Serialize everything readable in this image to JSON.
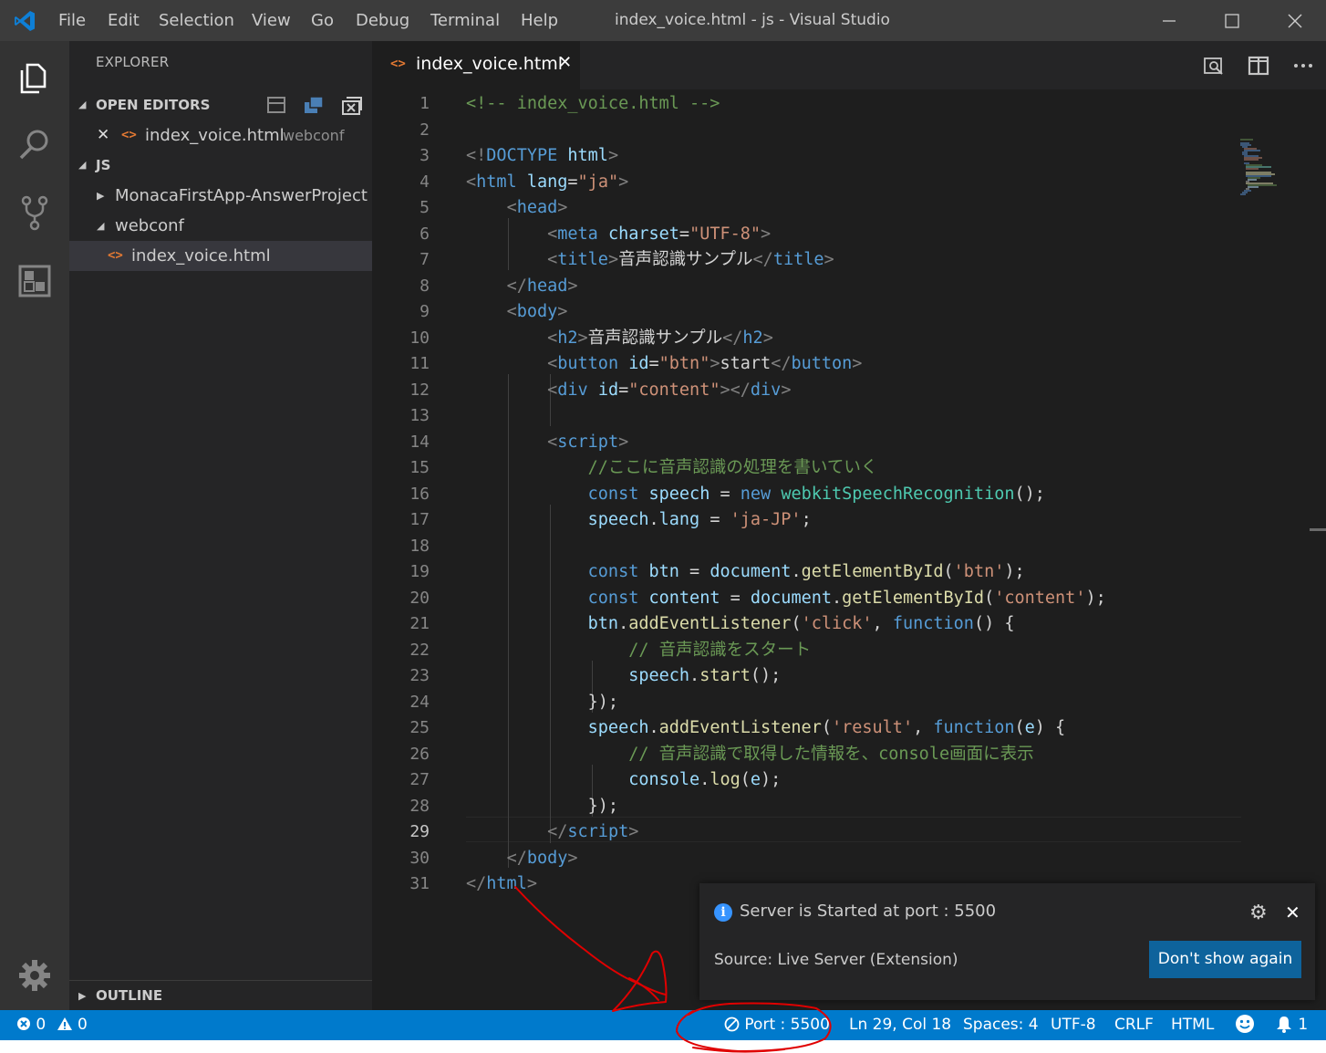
{
  "titlebar": {
    "menu": [
      "File",
      "Edit",
      "Selection",
      "View",
      "Go",
      "Debug",
      "Terminal",
      "Help"
    ],
    "window_title": "index_voice.html - js - Visual Studio Code"
  },
  "activitybar": {
    "icons": [
      "explorer-icon",
      "search-icon",
      "source-control-icon",
      "extensions-icon",
      "settings-gear-icon"
    ]
  },
  "sidebar": {
    "title": "EXPLORER",
    "open_editors": {
      "header": "OPEN EDITORS",
      "items": [
        {
          "close": "✕",
          "icon": "<>",
          "name": "index_voice.html",
          "folder": "webconf"
        }
      ]
    },
    "workspace": {
      "header": "JS",
      "items": [
        {
          "twisty": "▶",
          "name": "MonacaFirstApp-AnswerProject"
        },
        {
          "twisty": "◢",
          "name": "webconf"
        },
        {
          "icon": "<>",
          "name": "index_voice.html"
        }
      ]
    },
    "outline": {
      "twisty": "▶",
      "header": "OUTLINE"
    }
  },
  "editor": {
    "tab": {
      "icon": "<>",
      "label": "index_voice.html",
      "close": "✕"
    },
    "active_line": 29,
    "line_numbers": [
      "1",
      "2",
      "3",
      "4",
      "5",
      "6",
      "7",
      "8",
      "9",
      "10",
      "11",
      "12",
      "13",
      "14",
      "15",
      "16",
      "17",
      "18",
      "19",
      "20",
      "21",
      "22",
      "23",
      "24",
      "25",
      "26",
      "27",
      "28",
      "29",
      "30",
      "31"
    ],
    "lines": [
      [
        [
          "c",
          "<!-- index_voice.html -->"
        ]
      ],
      [],
      [
        [
          "b",
          "<!"
        ],
        [
          "tag",
          "DOCTYPE"
        ],
        [
          "txt",
          " "
        ],
        [
          "at",
          "html"
        ],
        [
          "b",
          ">"
        ]
      ],
      [
        [
          "b",
          "<"
        ],
        [
          "tag",
          "html"
        ],
        [
          "txt",
          " "
        ],
        [
          "at",
          "lang"
        ],
        [
          "txt",
          "="
        ],
        [
          "str",
          "\"ja\""
        ],
        [
          "b",
          ">"
        ]
      ],
      [
        [
          "txt",
          "    "
        ],
        [
          "b",
          "<"
        ],
        [
          "tag",
          "head"
        ],
        [
          "b",
          ">"
        ]
      ],
      [
        [
          "txt",
          "        "
        ],
        [
          "b",
          "<"
        ],
        [
          "tag",
          "meta"
        ],
        [
          "txt",
          " "
        ],
        [
          "at",
          "charset"
        ],
        [
          "txt",
          "="
        ],
        [
          "str",
          "\"UTF-8\""
        ],
        [
          "b",
          ">"
        ]
      ],
      [
        [
          "txt",
          "        "
        ],
        [
          "b",
          "<"
        ],
        [
          "tag",
          "title"
        ],
        [
          "b",
          ">"
        ],
        [
          "txt",
          "音声認識サンプル"
        ],
        [
          "b",
          "</"
        ],
        [
          "tag",
          "title"
        ],
        [
          "b",
          ">"
        ]
      ],
      [
        [
          "txt",
          "    "
        ],
        [
          "b",
          "</"
        ],
        [
          "tag",
          "head"
        ],
        [
          "b",
          ">"
        ]
      ],
      [
        [
          "txt",
          "    "
        ],
        [
          "b",
          "<"
        ],
        [
          "tag",
          "body"
        ],
        [
          "b",
          ">"
        ]
      ],
      [
        [
          "txt",
          "        "
        ],
        [
          "b",
          "<"
        ],
        [
          "tag",
          "h2"
        ],
        [
          "b",
          ">"
        ],
        [
          "txt",
          "音声認識サンプル"
        ],
        [
          "b",
          "</"
        ],
        [
          "tag",
          "h2"
        ],
        [
          "b",
          ">"
        ]
      ],
      [
        [
          "txt",
          "        "
        ],
        [
          "b",
          "<"
        ],
        [
          "tag",
          "button"
        ],
        [
          "txt",
          " "
        ],
        [
          "at",
          "id"
        ],
        [
          "txt",
          "="
        ],
        [
          "str",
          "\"btn\""
        ],
        [
          "b",
          ">"
        ],
        [
          "txt",
          "start"
        ],
        [
          "b",
          "</"
        ],
        [
          "tag",
          "button"
        ],
        [
          "b",
          ">"
        ]
      ],
      [
        [
          "txt",
          "        "
        ],
        [
          "b",
          "<"
        ],
        [
          "tag",
          "div"
        ],
        [
          "txt",
          " "
        ],
        [
          "at",
          "id"
        ],
        [
          "txt",
          "="
        ],
        [
          "str",
          "\"content\""
        ],
        [
          "b",
          "></"
        ],
        [
          "tag",
          "div"
        ],
        [
          "b",
          ">"
        ]
      ],
      [],
      [
        [
          "txt",
          "        "
        ],
        [
          "b",
          "<"
        ],
        [
          "tag",
          "script"
        ],
        [
          "b",
          ">"
        ]
      ],
      [
        [
          "txt",
          "            "
        ],
        [
          "c",
          "//ここに音声認識の処理を書いていく"
        ]
      ],
      [
        [
          "txt",
          "            "
        ],
        [
          "kw",
          "const"
        ],
        [
          "txt",
          " "
        ],
        [
          "var",
          "speech"
        ],
        [
          "txt",
          " = "
        ],
        [
          "kw",
          "new"
        ],
        [
          "txt",
          " "
        ],
        [
          "cls",
          "webkitSpeechRecognition"
        ],
        [
          "txt",
          "();"
        ]
      ],
      [
        [
          "txt",
          "            "
        ],
        [
          "var",
          "speech"
        ],
        [
          "txt",
          "."
        ],
        [
          "var",
          "lang"
        ],
        [
          "txt",
          " = "
        ],
        [
          "str",
          "'ja-JP'"
        ],
        [
          "txt",
          ";"
        ]
      ],
      [],
      [
        [
          "txt",
          "            "
        ],
        [
          "kw",
          "const"
        ],
        [
          "txt",
          " "
        ],
        [
          "var",
          "btn"
        ],
        [
          "txt",
          " = "
        ],
        [
          "var",
          "document"
        ],
        [
          "txt",
          "."
        ],
        [
          "fn",
          "getElementById"
        ],
        [
          "txt",
          "("
        ],
        [
          "str",
          "'btn'"
        ],
        [
          "txt",
          ");"
        ]
      ],
      [
        [
          "txt",
          "            "
        ],
        [
          "kw",
          "const"
        ],
        [
          "txt",
          " "
        ],
        [
          "var",
          "content"
        ],
        [
          "txt",
          " = "
        ],
        [
          "var",
          "document"
        ],
        [
          "txt",
          "."
        ],
        [
          "fn",
          "getElementById"
        ],
        [
          "txt",
          "("
        ],
        [
          "str",
          "'content'"
        ],
        [
          "txt",
          ");"
        ]
      ],
      [
        [
          "txt",
          "            "
        ],
        [
          "var",
          "btn"
        ],
        [
          "txt",
          "."
        ],
        [
          "fn",
          "addEventListener"
        ],
        [
          "txt",
          "("
        ],
        [
          "str",
          "'click'"
        ],
        [
          "txt",
          ", "
        ],
        [
          "kw",
          "function"
        ],
        [
          "txt",
          "() {"
        ]
      ],
      [
        [
          "txt",
          "                "
        ],
        [
          "c",
          "// 音声認識をスタート"
        ]
      ],
      [
        [
          "txt",
          "                "
        ],
        [
          "var",
          "speech"
        ],
        [
          "txt",
          "."
        ],
        [
          "fn",
          "start"
        ],
        [
          "txt",
          "();"
        ]
      ],
      [
        [
          "txt",
          "            });"
        ]
      ],
      [
        [
          "txt",
          "            "
        ],
        [
          "var",
          "speech"
        ],
        [
          "txt",
          "."
        ],
        [
          "fn",
          "addEventListener"
        ],
        [
          "txt",
          "("
        ],
        [
          "str",
          "'result'"
        ],
        [
          "txt",
          ", "
        ],
        [
          "kw",
          "function"
        ],
        [
          "txt",
          "("
        ],
        [
          "var",
          "e"
        ],
        [
          "txt",
          ") {"
        ]
      ],
      [
        [
          "txt",
          "                "
        ],
        [
          "c",
          "// 音声認識で取得した情報を、console画面に表示"
        ]
      ],
      [
        [
          "txt",
          "                "
        ],
        [
          "var",
          "console"
        ],
        [
          "txt",
          "."
        ],
        [
          "fn",
          "log"
        ],
        [
          "txt",
          "("
        ],
        [
          "var",
          "e"
        ],
        [
          "txt",
          ");"
        ]
      ],
      [
        [
          "txt",
          "            });"
        ]
      ],
      [
        [
          "txt",
          "        "
        ],
        [
          "b",
          "</"
        ],
        [
          "tag",
          "script"
        ],
        [
          "b",
          ">"
        ]
      ],
      [
        [
          "txt",
          "    "
        ],
        [
          "b",
          "</"
        ],
        [
          "tag",
          "body"
        ],
        [
          "b",
          ">"
        ]
      ],
      [
        [
          "b",
          "</"
        ],
        [
          "tag",
          "html"
        ],
        [
          "b",
          ">"
        ]
      ]
    ]
  },
  "notification": {
    "message": "Server is Started at port : 5500",
    "source": "Source: Live Server (Extension)",
    "button": "Don't show again",
    "close": "✕",
    "gear": "⚙"
  },
  "statusbar": {
    "errors": "0",
    "warnings": "0",
    "port": "Port : 5500",
    "position": "Ln 29, Col 18",
    "spaces": "Spaces: 4",
    "encoding": "UTF-8",
    "eol": "CRLF",
    "language": "HTML",
    "notifications": "1"
  },
  "colors": {
    "statusbar": "#007acc",
    "annotation": "#e00000"
  }
}
